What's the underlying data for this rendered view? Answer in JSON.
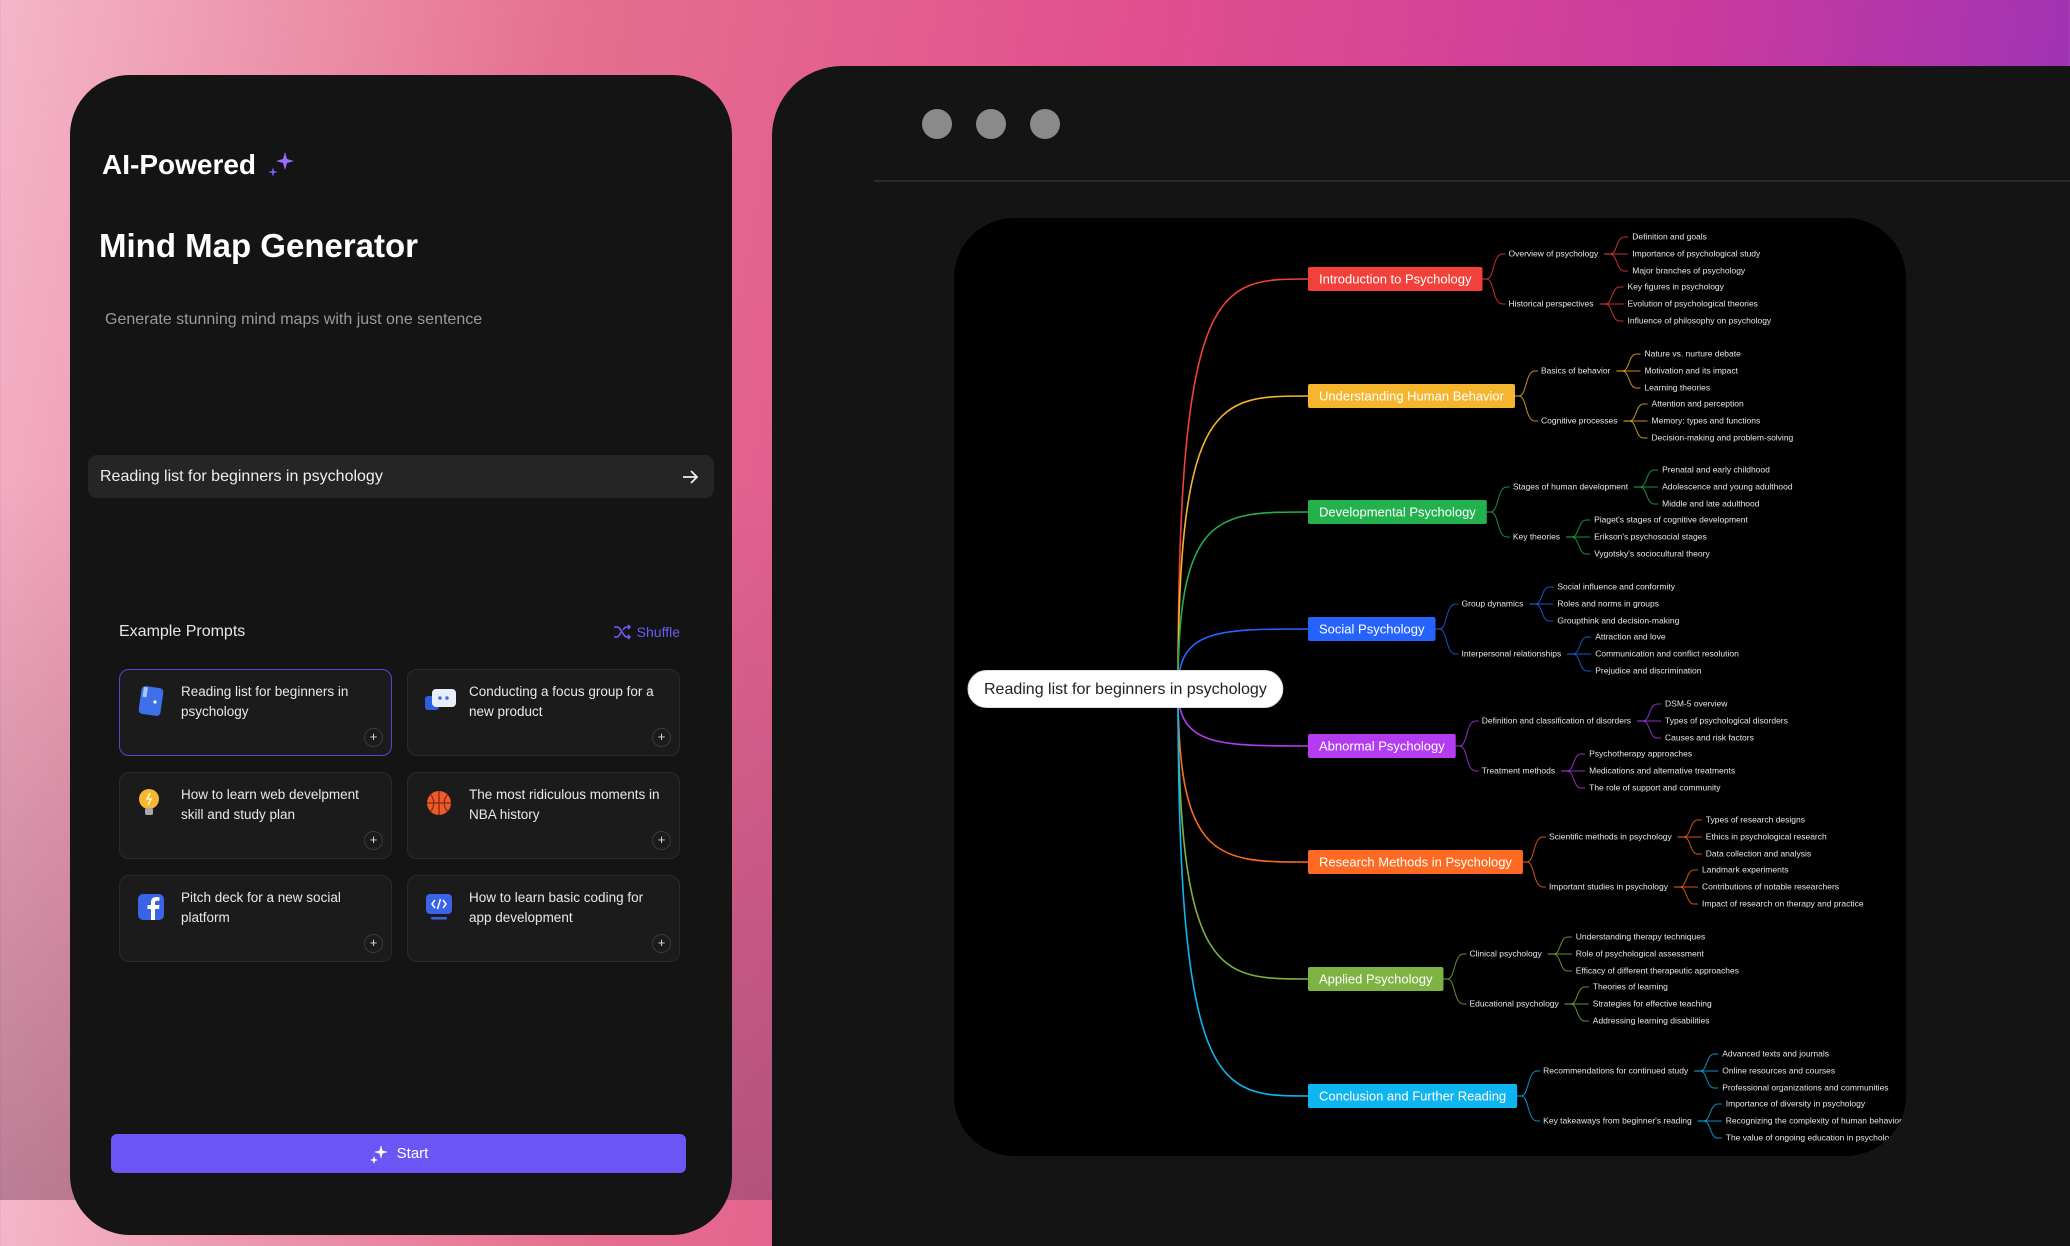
{
  "left_panel": {
    "brand": "AI-Powered",
    "title": "Mind Map Generator",
    "subtitle": "Generate stunning mind maps with just one sentence",
    "input_value": "Reading list for beginners in psychology",
    "examples_label": "Example Prompts",
    "shuffle_label": "Shuffle",
    "examples": [
      {
        "text": "Reading list for beginners in psychology",
        "icon": "book-icon",
        "selected": true
      },
      {
        "text": "Conducting a focus group for a new product",
        "icon": "chat-bubbles-icon",
        "selected": false
      },
      {
        "text": "How to learn web develpment skill and study plan",
        "icon": "lightbulb-icon",
        "selected": false
      },
      {
        "text": "The most ridiculous moments in NBA history",
        "icon": "basketball-icon",
        "selected": false
      },
      {
        "text": "Pitch deck for a new social platform",
        "icon": "facebook-icon",
        "selected": false
      },
      {
        "text": "How to learn basic coding for app development",
        "icon": "code-monitor-icon",
        "selected": false
      }
    ],
    "start_label": "Start",
    "accent": "#6c55f5"
  },
  "mindmap": {
    "root": "Reading list for beginners in psychology",
    "branches": [
      {
        "label": "Introduction to Psychology",
        "color": "#f2413a",
        "subs": [
          {
            "label": "Overview of psychology",
            "leaves": [
              "Definition and goals",
              "Importance of psychological study",
              "Major branches of psychology"
            ]
          },
          {
            "label": "Historical perspectives",
            "leaves": [
              "Key figures in psychology",
              "Evolution of psychological theories",
              "Influence of philosophy on psychology"
            ]
          }
        ]
      },
      {
        "label": "Understanding Human Behavior",
        "color": "#f5b52e",
        "subs": [
          {
            "label": "Basics of behavior",
            "leaves": [
              "Nature vs. nurture debate",
              "Motivation and its impact",
              "Learning theories"
            ]
          },
          {
            "label": "Cognitive processes",
            "leaves": [
              "Attention and perception",
              "Memory: types and functions",
              "Decision-making and problem-solving"
            ]
          }
        ]
      },
      {
        "label": "Developmental Psychology",
        "color": "#23b14d",
        "subs": [
          {
            "label": "Stages of human development",
            "leaves": [
              "Prenatal and early childhood",
              "Adolescence and young adulthood",
              "Middle and late adulthood"
            ]
          },
          {
            "label": "Key theories",
            "leaves": [
              "Piaget's stages of cognitive development",
              "Erikson's psychosocial stages",
              "Vygotsky's sociocultural theory"
            ]
          }
        ]
      },
      {
        "label": "Social Psychology",
        "color": "#2563ff",
        "subs": [
          {
            "label": "Group dynamics",
            "leaves": [
              "Social influence and conformity",
              "Roles and norms in groups",
              "Groupthink and decision-making"
            ]
          },
          {
            "label": "Interpersonal relationships",
            "leaves": [
              "Attraction and love",
              "Communication and conflict resolution",
              "Prejudice and discrimination"
            ]
          }
        ]
      },
      {
        "label": "Abnormal Psychology",
        "color": "#b43cf0",
        "subs": [
          {
            "label": "Definition and classification of disorders",
            "leaves": [
              "DSM-5 overview",
              "Types of psychological disorders",
              "Causes and risk factors"
            ]
          },
          {
            "label": "Treatment methods",
            "leaves": [
              "Psychotherapy approaches",
              "Medications and alternative treatments",
              "The role of support and community"
            ]
          }
        ]
      },
      {
        "label": "Research Methods in Psychology",
        "color": "#ff6a22",
        "subs": [
          {
            "label": "Scientific methods in psychology",
            "leaves": [
              "Types of research designs",
              "Ethics in psychological research",
              "Data collection and analysis"
            ]
          },
          {
            "label": "Important studies in psychology",
            "leaves": [
              "Landmark experiments",
              "Contributions of notable researchers",
              "Impact of research on therapy and practice"
            ]
          }
        ]
      },
      {
        "label": "Applied Psychology",
        "color": "#7cb342",
        "subs": [
          {
            "label": "Clinical psychology",
            "leaves": [
              "Understanding therapy techniques",
              "Role of psychological assessment",
              "Efficacy of different therapeutic approaches"
            ]
          },
          {
            "label": "Educational psychology",
            "leaves": [
              "Theories of learning",
              "Strategies for effective teaching",
              "Addressing learning disabilities"
            ]
          }
        ]
      },
      {
        "label": "Conclusion and Further Reading",
        "color": "#0fb5f0",
        "subs": [
          {
            "label": "Recommendations for continued study",
            "leaves": [
              "Advanced texts and journals",
              "Online resources and courses",
              "Professional organizations and communities"
            ]
          },
          {
            "label": "Key takeaways from beginner's reading",
            "leaves": [
              "Importance of diversity in psychology",
              "Recognizing the complexity of human behavior",
              "The value of ongoing education in psychology"
            ]
          }
        ]
      }
    ]
  }
}
